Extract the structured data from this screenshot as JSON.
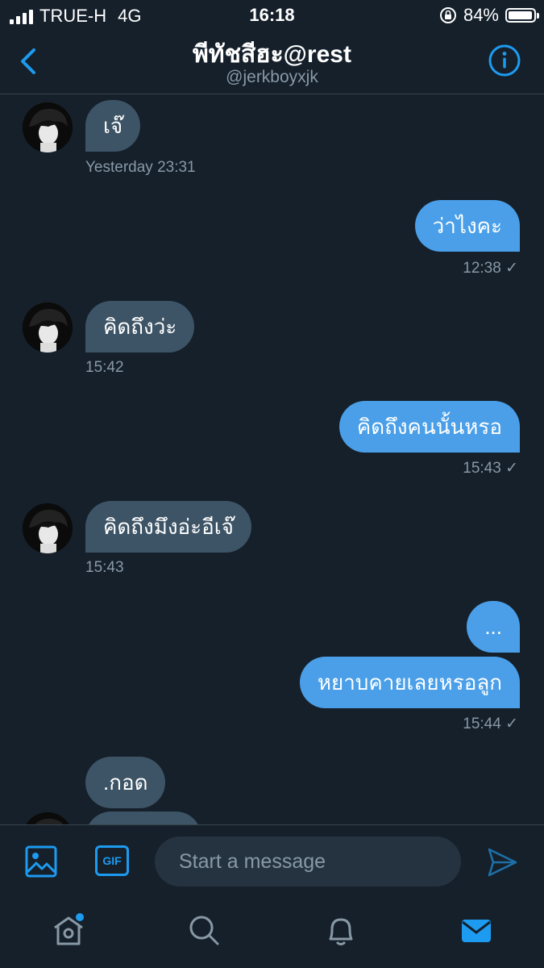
{
  "status_bar": {
    "carrier": "TRUE-H",
    "network": "4G",
    "time": "16:18",
    "battery": "84%"
  },
  "header": {
    "title": "พีทัชสีฮะ@rest",
    "handle": "@jerkboyxjk"
  },
  "messages": [
    {
      "from": "them",
      "text": "เจ๊"
    },
    {
      "from": "me",
      "text": "ว่าไงคะ"
    },
    {
      "from": "them",
      "text": "คิดถึงว่ะ"
    },
    {
      "from": "me",
      "text": "คิดถึงคนนั้นหรอ"
    },
    {
      "from": "them",
      "text": "คิดถึงมึงอ่ะอีเจ๊"
    },
    {
      "from": "me",
      "text": "..."
    },
    {
      "from": "me",
      "text": "หยาบคายเลยหรอลูก"
    },
    {
      "from": "them",
      "text": ".กอด"
    }
  ],
  "timestamps": [
    "Yesterday 23:31",
    "12:38 ✓",
    "15:42",
    "15:43 ✓",
    "15:43",
    "15:44 ✓"
  ],
  "composer": {
    "placeholder": "Start a message",
    "gif_label": "GIF"
  },
  "icons": {
    "back": "back-arrow-icon",
    "info": "info-icon",
    "image": "image-icon",
    "send": "send-icon",
    "tabs": [
      "home-icon",
      "search-icon",
      "notifications-icon",
      "messages-icon"
    ]
  },
  "colors": {
    "background": "#15202b",
    "accent": "#1d9bf0",
    "received_bubble": "#3d5466",
    "sent_bubble": "#4a9fe8",
    "muted": "#8899a6"
  }
}
